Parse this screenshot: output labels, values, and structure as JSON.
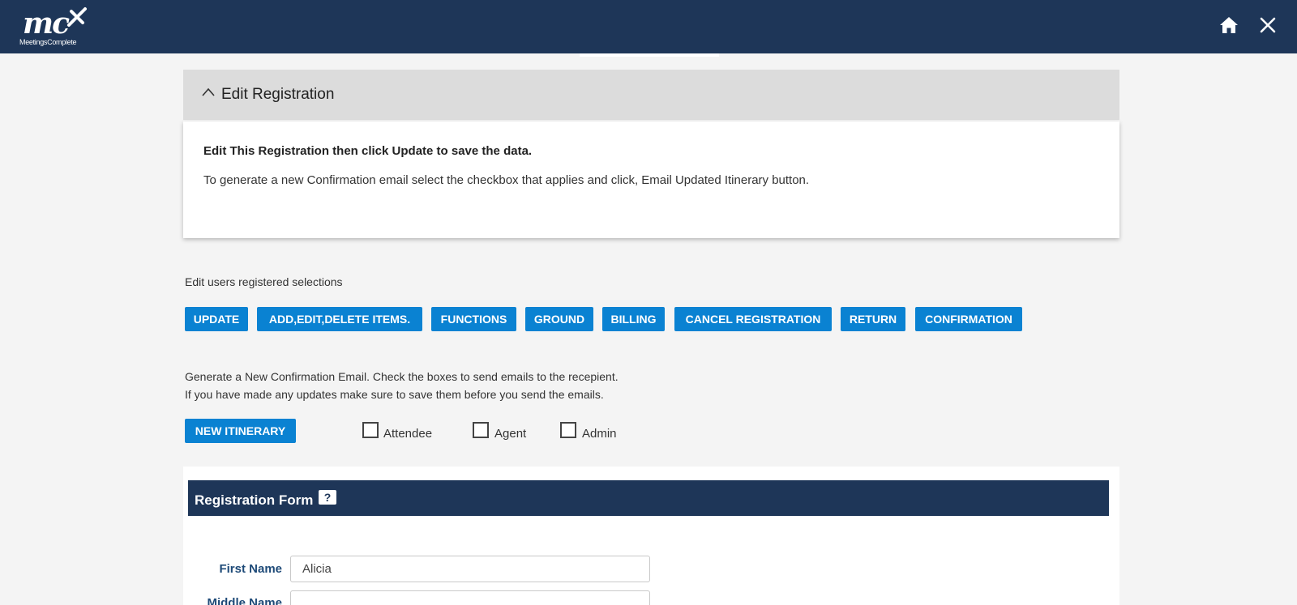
{
  "header": {
    "logo_text": "mc",
    "logo_subtext": "MeetingsComplete",
    "icons": [
      "home-icon",
      "close-icon"
    ],
    "background_color": "#1e3658"
  },
  "panel": {
    "title": "Edit Registration",
    "lead": "Edit This Registration then click Update to save the data.",
    "description": "To generate a new Confirmation email select the checkbox that applies and click, Email Updated Itinerary button."
  },
  "actions": {
    "label": "Edit users registered selections",
    "buttons": [
      {
        "label": "UPDATE"
      },
      {
        "label": "ADD,EDIT,DELETE ITEMS."
      },
      {
        "label": "FUNCTIONS"
      },
      {
        "label": "GROUND"
      },
      {
        "label": "BILLING"
      },
      {
        "label": "CANCEL REGISTRATION"
      },
      {
        "label": "RETURN"
      },
      {
        "label": "CONFIRMATION"
      }
    ],
    "button_color": "#0a82d2"
  },
  "confirmation": {
    "line1": "Generate a New Confirmation Email. Check the boxes to send emails to the recepient.",
    "line2": "If you have made any updates make sure to save them before you send the emails.",
    "button_label": "NEW ITINERARY",
    "checkboxes": [
      {
        "label": "Attendee",
        "checked": false
      },
      {
        "label": "Agent",
        "checked": false
      },
      {
        "label": "Admin",
        "checked": false
      }
    ]
  },
  "form": {
    "title": "Registration Form",
    "help_label": "?",
    "fields": [
      {
        "label": "First Name",
        "value": "Alicia"
      },
      {
        "label": "Middle Name",
        "value": ""
      }
    ]
  }
}
